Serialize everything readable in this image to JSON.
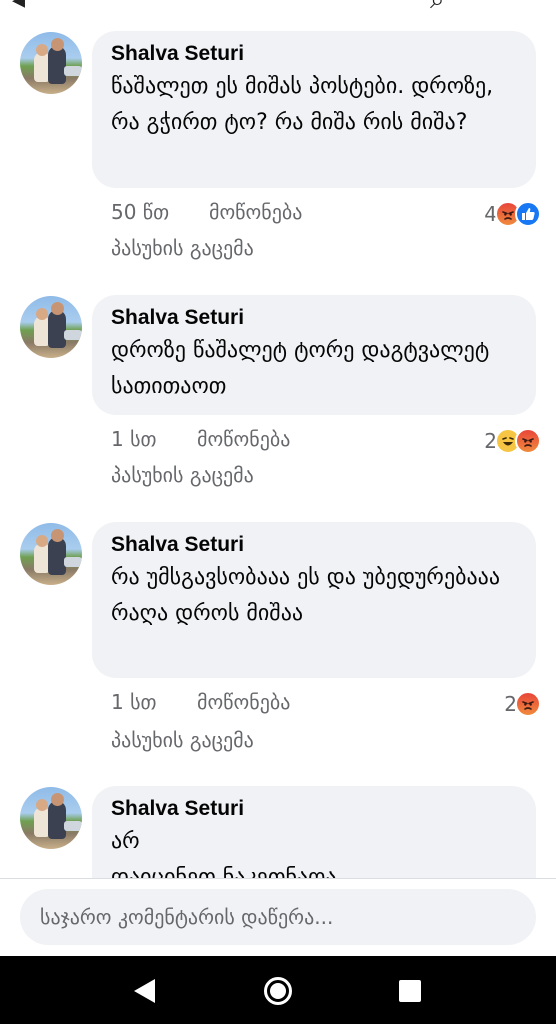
{
  "comments": [
    {
      "author": "Shalva Seturi",
      "text": "წაშალეთ ეს მიშას პოსტები. დროზე, რა გჭირთ ტო? რა მიშა რის მიშა?",
      "time": "50 წთ",
      "like_label": "მოწონება",
      "reply_label": "პასუხის გაცემა",
      "reaction_count": "4",
      "reactions": [
        "angry-emoji",
        "like-emoji"
      ]
    },
    {
      "author": "Shalva Seturi",
      "text": "დროზე წაშალეტ ტორე დაგტვალეტ სათითაოთ",
      "time": "1 სთ",
      "like_label": "მოწონება",
      "reply_label": "პასუხის გაცემა",
      "reaction_count": "2",
      "reactions": [
        "haha-emoji",
        "angry-emoji"
      ]
    },
    {
      "author": "Shalva Seturi",
      "text": "რა უმსგავსობააა ეს და უბედურებააა რაღა დროს მიშაა",
      "time": "1 სთ",
      "like_label": "მოწონება",
      "reply_label": "პასუხის გაცემა",
      "reaction_count": "2",
      "reactions": [
        "angry-emoji"
      ]
    },
    {
      "author": "Shalva Seturi",
      "text": "არ",
      "text_cut": "დაიცინეთ ნაკეთნაოა"
    }
  ],
  "composer": {
    "placeholder": "საჯარო კომენტარის დაწერა..."
  },
  "navbar": {
    "icons": [
      "back-icon",
      "home-icon",
      "recents-icon"
    ]
  },
  "colors": {
    "bubble": "#f0f2f5",
    "meta_text": "#65676b",
    "like_blue": "#1877f2",
    "angry_red": "#e8463b"
  }
}
